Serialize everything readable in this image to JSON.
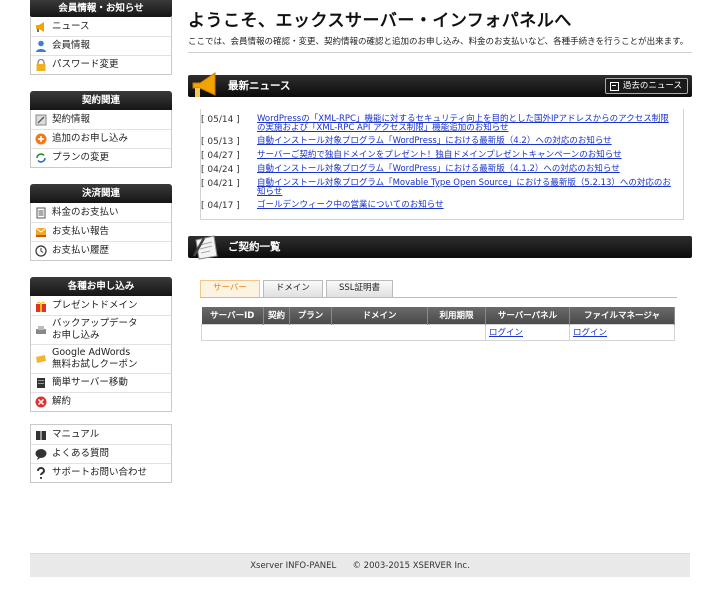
{
  "sidebar": {
    "member": {
      "title": "会員情報・お知らせ",
      "items": [
        {
          "label": "ニュース",
          "icon": "megaphone-icon"
        },
        {
          "label": "会員情報",
          "icon": "user-icon"
        },
        {
          "label": "パスワード変更",
          "icon": "lock-icon"
        }
      ]
    },
    "contract": {
      "title": "契約関連",
      "items": [
        {
          "label": "契約情報",
          "icon": "document-icon"
        },
        {
          "label": "追加のお申し込み",
          "icon": "plus-icon"
        },
        {
          "label": "プランの変更",
          "icon": "refresh-icon"
        }
      ]
    },
    "payment": {
      "title": "決済関連",
      "items": [
        {
          "label": "料金のお支払い",
          "icon": "invoice-icon"
        },
        {
          "label": "お支払い報告",
          "icon": "envelope-icon"
        },
        {
          "label": "お支払い履歴",
          "icon": "clock-icon"
        }
      ]
    },
    "apply": {
      "title": "各種お申し込み",
      "items": [
        {
          "label": "プレゼントドメイン",
          "icon": "gift-icon"
        },
        {
          "label": "バックアップデータ\nお申し込み",
          "icon": "backup-icon"
        },
        {
          "label": "Google AdWords\n無料お試しクーポン",
          "icon": "coupon-icon"
        },
        {
          "label": "簡単サーバー移動",
          "icon": "server-icon"
        },
        {
          "label": "解約",
          "icon": "cancel-icon"
        }
      ]
    },
    "help": {
      "items": [
        {
          "label": "マニュアル",
          "icon": "book-icon"
        },
        {
          "label": "よくある質問",
          "icon": "speech-bubble-icon"
        },
        {
          "label": "サポートお問い合わせ",
          "icon": "question-icon"
        }
      ]
    }
  },
  "main": {
    "title": "ようこそ、エックスサーバー・インフォパネルへ",
    "description": "ここでは、会員情報の確認・変更、契約情報の確認と追加のお申し込み、料金のお支払いなど、各種手続きを行うことが出来ます。",
    "news": {
      "title": "最新ニュース",
      "past_label": "過去のニュース",
      "items": [
        {
          "date": "[ 05/14 ]",
          "text": "WordPressの「XML-RPC」機能に対するセキュリティ向上を目的とした国外IPアドレスからのアクセス制限の実施および「XML-RPC API アクセス制限」機能追加のお知らせ"
        },
        {
          "date": "[ 05/13 ]",
          "text": "自動インストール対象プログラム「WordPress」における最新版（4.2）への対応のお知らせ"
        },
        {
          "date": "[ 04/27 ]",
          "text": "サーバーご契約で独自ドメインをプレゼント！独自ドメインプレゼントキャンペーンのお知らせ"
        },
        {
          "date": "[ 04/24 ]",
          "text": "自動インストール対象プログラム「WordPress」における最新版（4.1.2）への対応のお知らせ"
        },
        {
          "date": "[ 04/21 ]",
          "text": "自動インストール対象プログラム「Movable Type Open Source」における最新版（5.2.13）への対応のお知らせ"
        },
        {
          "date": "[ 04/17 ]",
          "text": "ゴールデンウィーク中の営業についてのお知らせ"
        }
      ]
    },
    "contracts": {
      "title": "ご契約一覧",
      "tabs": [
        "サーバー",
        "ドメイン",
        "SSL証明書"
      ],
      "columns": [
        "サーバーID",
        "契約",
        "プラン",
        "ドメイン",
        "利用期限",
        "サーバーパネル",
        "ファイルマネージャ"
      ],
      "row": {
        "server_id": "",
        "contract": "",
        "plan": "",
        "domain": "",
        "expiry": "",
        "server_panel": "ログイン",
        "file_manager": "ログイン"
      }
    }
  },
  "footer": {
    "product": "Xserver INFO-PANEL",
    "copyright": "© 2003-2015 XSERVER Inc."
  }
}
